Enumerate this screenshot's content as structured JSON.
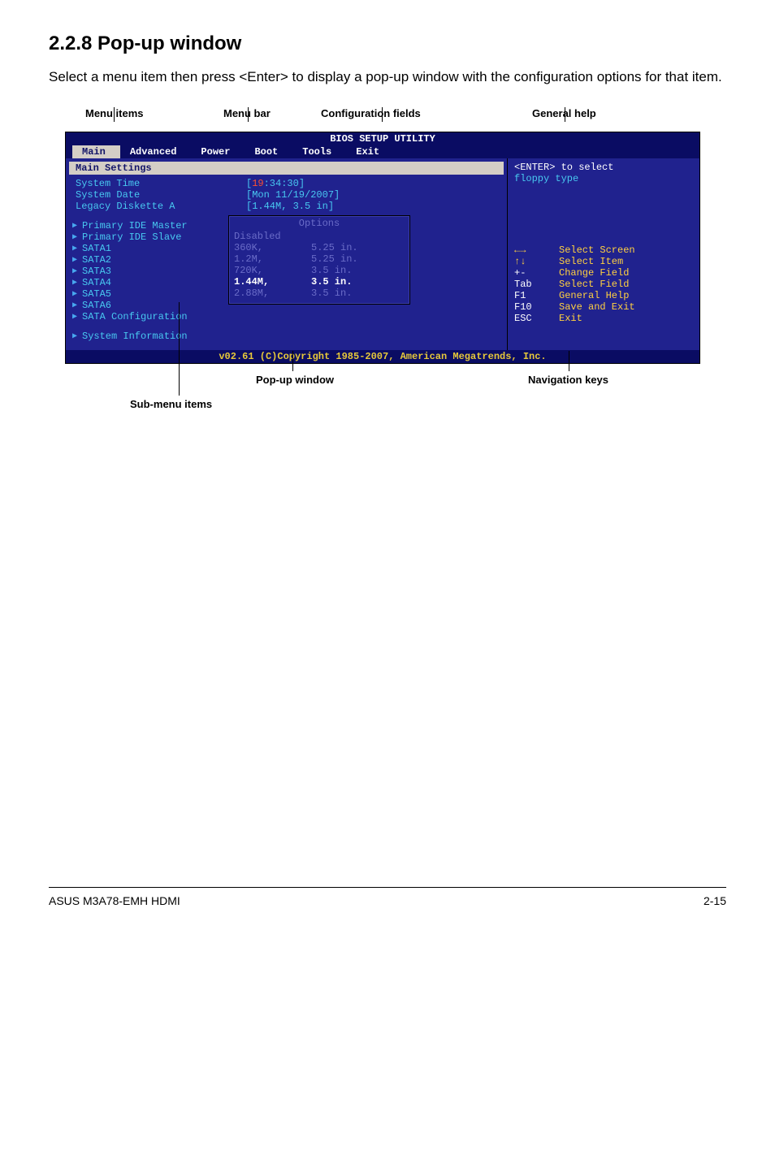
{
  "heading": "2.2.8     Pop-up window",
  "desc": "Select a menu item then press <Enter> to display a pop-up window with the configuration options for that item.",
  "top_labels": {
    "menu_items": "Menu items",
    "menu_bar": "Menu bar",
    "config_fields": "Configuration fields",
    "general_help": "General help"
  },
  "bios": {
    "title": "BIOS SETUP UTILITY",
    "tabs": [
      "Main",
      "Advanced",
      "Power",
      "Boot",
      "Tools",
      "Exit"
    ],
    "active_tab": "Main",
    "section_header": "Main Settings",
    "fields": [
      {
        "k": "System Time",
        "hh": "19",
        "rest": ":34:30]"
      },
      {
        "k": "System Date",
        "v": "[Mon 11/19/2007]"
      },
      {
        "k": "Legacy Diskette A",
        "v": "[1.44M, 3.5 in]"
      }
    ],
    "submenus": [
      "Primary IDE Master",
      "Primary IDE Slave",
      "SATA1",
      "SATA2",
      "SATA3",
      "SATA4",
      "SATA5",
      "SATA6",
      "SATA Configuration",
      "System Information"
    ],
    "popup": {
      "title": "Options",
      "items": [
        {
          "k": "Disabled",
          "v": ""
        },
        {
          "k": "360K,",
          "v": "5.25 in."
        },
        {
          "k": "1.2M,",
          "v": "5.25 in."
        },
        {
          "k": "720K,",
          "v": "3.5 in."
        },
        {
          "k": "1.44M,",
          "v": "3.5 in.",
          "selected": true
        },
        {
          "k": "2.88M,",
          "v": "3.5 in."
        }
      ]
    },
    "help": {
      "line1": "<ENTER> to select",
      "line2": "floppy type",
      "keys": [
        {
          "k": "←→",
          "v": "Select Screen",
          "glyph": true
        },
        {
          "k": "↑↓",
          "v": "Select Item",
          "glyph": true
        },
        {
          "k": "+-",
          "v": "Change Field"
        },
        {
          "k": "Tab",
          "v": "Select Field"
        },
        {
          "k": "F1",
          "v": "General Help"
        },
        {
          "k": "F10",
          "v": "Save and Exit"
        },
        {
          "k": "ESC",
          "v": "Exit"
        }
      ]
    },
    "footer": "v02.61 (C)Copyright 1985-2007, American Megatrends, Inc."
  },
  "bottom_labels": {
    "popup_window": "Pop-up window",
    "nav_keys": "Navigation keys",
    "sub_menu_items": "Sub-menu items"
  },
  "page_footer_left": "ASUS M3A78-EMH HDMI",
  "page_footer_right": "2-15"
}
